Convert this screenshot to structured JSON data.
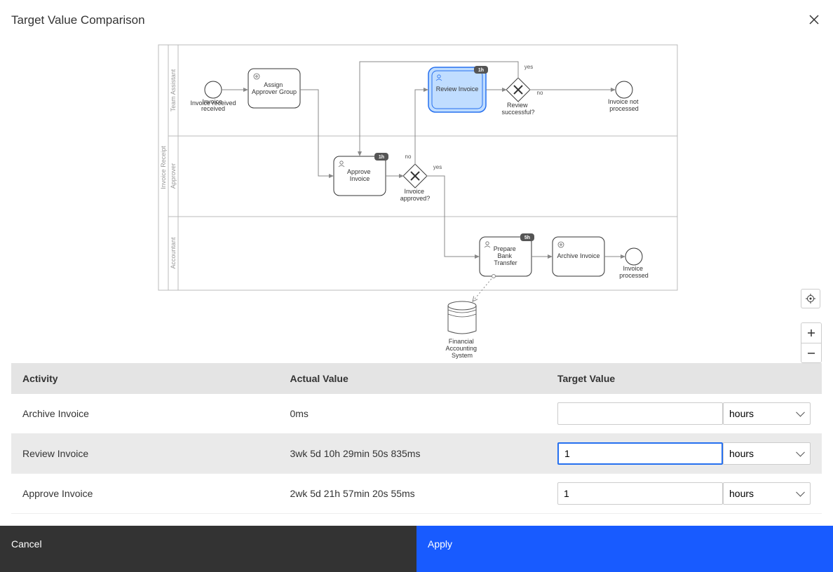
{
  "header": {
    "title": "Target Value Comparison"
  },
  "diagram": {
    "pool": "Invoice Receipt",
    "lanes": [
      "Team Assistant",
      "Approver",
      "Accountant"
    ],
    "nodes": {
      "start": {
        "label": "Invoice received"
      },
      "assign": {
        "label1": "Assign",
        "label2": "Approver Group"
      },
      "review": {
        "label": "Review Invoice",
        "badge": "1h"
      },
      "gw_review": {
        "label1": "Review",
        "label2": "successful?"
      },
      "end_not": {
        "label1": "Invoice not",
        "label2": "processed"
      },
      "approve": {
        "label1": "Approve",
        "label2": "Invoice",
        "badge": "1h"
      },
      "gw_approve": {
        "label1": "Invoice",
        "label2": "approved?"
      },
      "prepare": {
        "label1": "Prepare",
        "label2": "Bank",
        "label3": "Transfer",
        "badge": "5h"
      },
      "archive": {
        "label": "Archive Invoice"
      },
      "end_done": {
        "label1": "Invoice",
        "label2": "processed"
      },
      "db": {
        "label1": "Financial",
        "label2": "Accounting",
        "label3": "System"
      }
    },
    "edges": {
      "yes": "yes",
      "no": "no"
    }
  },
  "table": {
    "columns": {
      "activity": "Activity",
      "actual": "Actual Value",
      "target": "Target Value"
    },
    "rows": [
      {
        "activity": "Archive Invoice",
        "actual": "0ms",
        "target_value": "",
        "target_unit": "hours",
        "selected": false
      },
      {
        "activity": "Review Invoice",
        "actual": "3wk 5d 10h 29min 50s 835ms",
        "target_value": "1",
        "target_unit": "hours",
        "selected": true,
        "focused": true
      },
      {
        "activity": "Approve Invoice",
        "actual": "2wk 5d 21h 57min 20s 55ms",
        "target_value": "1",
        "target_unit": "hours",
        "selected": false
      }
    ],
    "unit_option": "hours"
  },
  "footer": {
    "cancel": "Cancel",
    "apply": "Apply"
  }
}
